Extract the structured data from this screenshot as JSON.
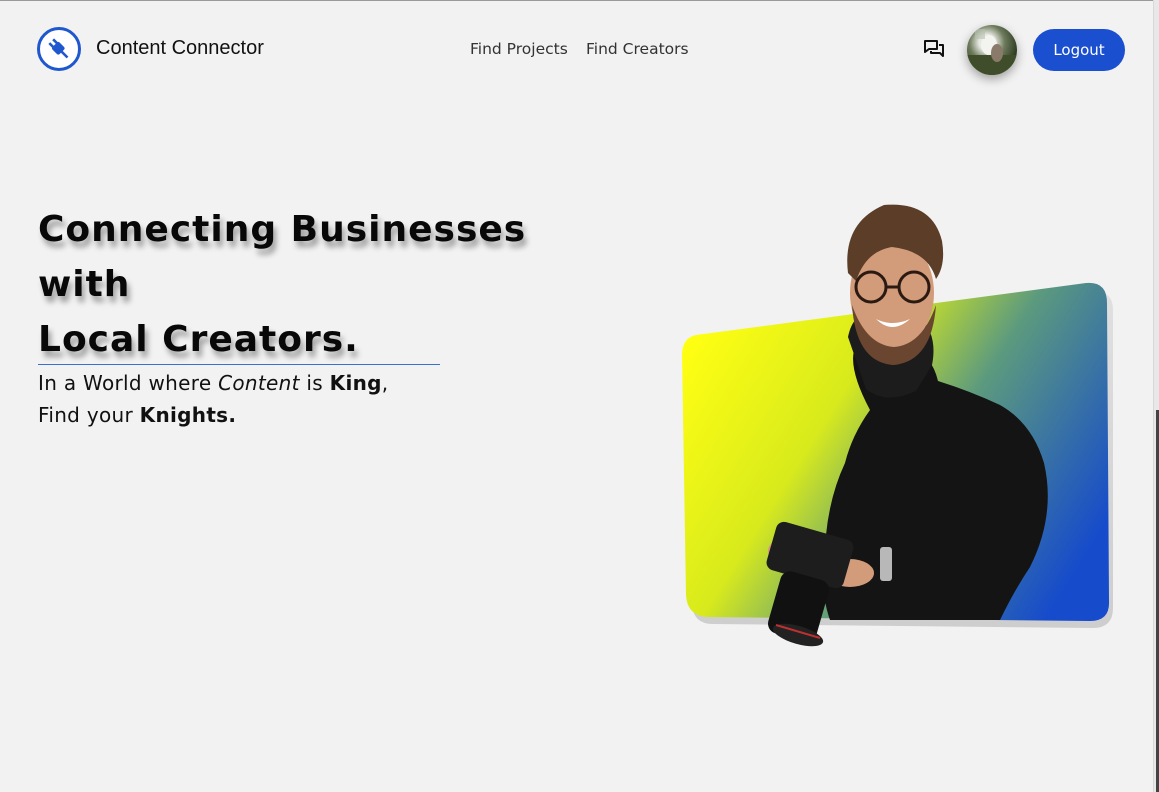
{
  "header": {
    "brand": "Content Connector",
    "nav": [
      {
        "label": "Find Projects"
      },
      {
        "label": "Find Creators"
      }
    ],
    "logout_label": "Logout",
    "icons": {
      "logo": "plug-icon",
      "messages": "chat-icon",
      "avatar": "user-avatar"
    }
  },
  "hero": {
    "title_line1": "Connecting Businesses",
    "title_line2": "with",
    "title_line3": "Local Creators.",
    "sub_part1": "In a World where ",
    "sub_italic": "Content",
    "sub_part2": " is ",
    "sub_bold1": "King",
    "sub_part3": ",",
    "sub_part4": "Find your ",
    "sub_bold2": "Knights."
  },
  "colors": {
    "accent": "#1a4fcf",
    "background": "#f2f2f2",
    "gradient_start": "#ffff12",
    "gradient_end": "#164bcb"
  }
}
